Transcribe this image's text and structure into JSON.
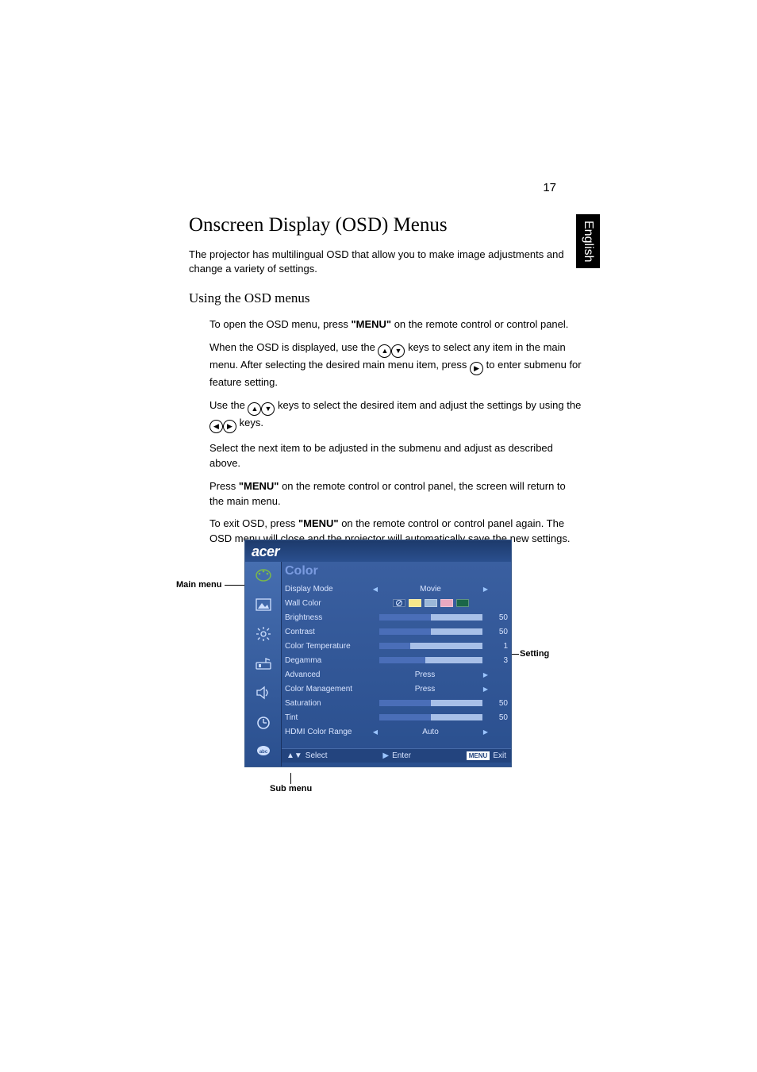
{
  "page_number": "17",
  "side_tab": "English",
  "heading": "Onscreen Display (OSD) Menus",
  "intro": "The projector has multilingual OSD that allow you to make image adjustments and change a variety of settings.",
  "subheading": "Using the OSD menus",
  "steps": {
    "s1a": "To open the OSD menu, press ",
    "s1b": "\"MENU\"",
    "s1c": " on the remote control or control panel.",
    "s2a": "When the OSD is displayed, use the ",
    "s2b": " keys to select any item in the main menu. After selecting the desired main menu item, press ",
    "s2c": " to enter submenu for feature setting.",
    "s3a": "Use the ",
    "s3b": " keys to select the desired item and adjust the settings by using the ",
    "s3c": " keys.",
    "s4": "Select the next item to be adjusted in the submenu and adjust as described above.",
    "s5a": "Press ",
    "s5b": "\"MENU\"",
    "s5c": " on the remote control or control panel, the screen will return to the main menu.",
    "s6a": "To exit OSD, press ",
    "s6b": "\"MENU\"",
    "s6c": " on the remote control or control panel again. The OSD menu will close and the projector will automatically save the new settings."
  },
  "annotations": {
    "main_menu": "Main menu",
    "setting": "Setting",
    "sub_menu": "Sub menu"
  },
  "osd": {
    "brand": "acer",
    "title": "Color",
    "rows": {
      "display_mode": {
        "label": "Display Mode",
        "value": "Movie"
      },
      "wall_color": {
        "label": "Wall Color"
      },
      "brightness": {
        "label": "Brightness",
        "value": "50"
      },
      "contrast": {
        "label": "Contrast",
        "value": "50"
      },
      "color_temp": {
        "label": "Color Temperature",
        "value": "1"
      },
      "degamma": {
        "label": "Degamma",
        "value": "3"
      },
      "advanced": {
        "label": "Advanced",
        "value": "Press"
      },
      "color_mgmt": {
        "label": "Color Management",
        "value": "Press"
      },
      "saturation": {
        "label": "Saturation",
        "value": "50"
      },
      "tint": {
        "label": "Tint",
        "value": "50"
      },
      "hdmi_range": {
        "label": "HDMI Color Range",
        "value": "Auto"
      }
    },
    "footer": {
      "select": "Select",
      "enter": "Enter",
      "menu": "MENU",
      "exit": "Exit"
    }
  }
}
